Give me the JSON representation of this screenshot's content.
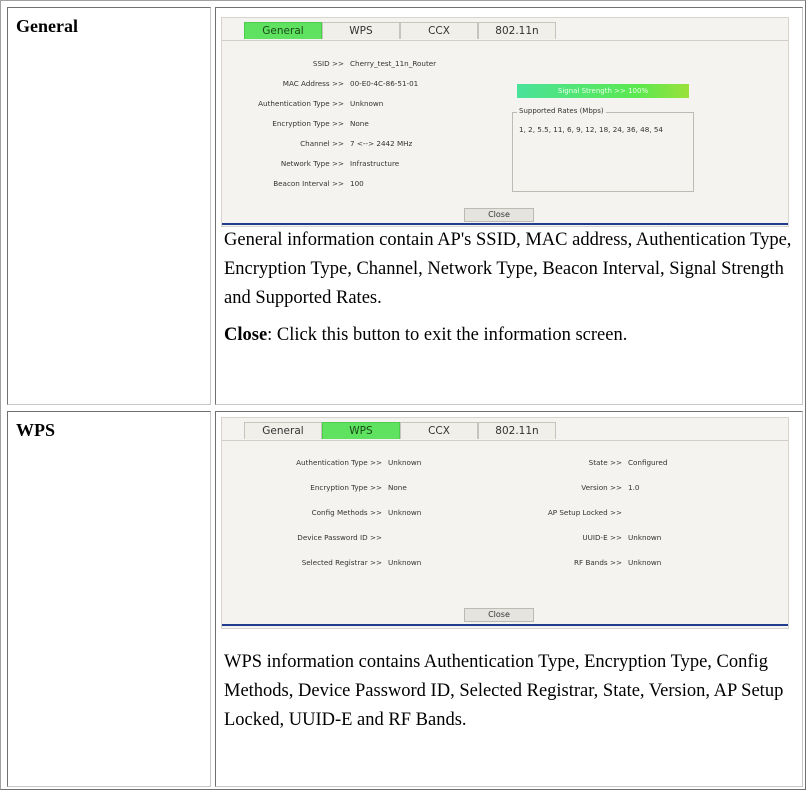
{
  "rows": [
    {
      "label": "General",
      "dialog": {
        "tabs": [
          "General",
          "WPS",
          "CCX",
          "802.11n"
        ],
        "active_tab": "General",
        "fields": [
          {
            "key": "SSID >>",
            "value": "Cherry_test_11n_Router"
          },
          {
            "key": "MAC Address >>",
            "value": "00-E0-4C-86-51-01"
          },
          {
            "key": "Authentication Type >>",
            "value": "Unknown"
          },
          {
            "key": "Encryption Type >>",
            "value": "None"
          },
          {
            "key": "Channel >>",
            "value": "7 <--> 2442 MHz"
          },
          {
            "key": "Network Type >>",
            "value": "Infrastructure"
          },
          {
            "key": "Beacon Interval >>",
            "value": "100"
          }
        ],
        "signal_text": "Signal Strength >> 100%",
        "signal_percent": 100,
        "rates_title": "Supported Rates (Mbps)",
        "rates_value": "1, 2, 5.5, 11, 6, 9, 12, 18, 24, 36, 48, 54",
        "close_label": "Close"
      },
      "description": "General information contain AP's SSID, MAC address, Authentication Type, Encryption Type, Channel, Network Type, Beacon Interval, Signal Strength and Supported Rates.",
      "close_term": "Close",
      "close_desc": ": Click this button to exit the information screen."
    },
    {
      "label": "WPS",
      "dialog": {
        "tabs": [
          "General",
          "WPS",
          "CCX",
          "802.11n"
        ],
        "active_tab": "WPS",
        "left_fields": [
          {
            "key": "Authentication Type >>",
            "value": "Unknown"
          },
          {
            "key": "Encryption Type >>",
            "value": "None"
          },
          {
            "key": "Config Methods >>",
            "value": "Unknown"
          },
          {
            "key": "Device Password ID >>",
            "value": ""
          },
          {
            "key": "Selected Registrar >>",
            "value": "Unknown"
          }
        ],
        "right_fields": [
          {
            "key": "State >>",
            "value": "Configured"
          },
          {
            "key": "Version >>",
            "value": "1.0"
          },
          {
            "key": "AP Setup Locked >>",
            "value": ""
          },
          {
            "key": "UUID-E >>",
            "value": "Unknown"
          },
          {
            "key": "RF Bands >>",
            "value": "Unknown"
          }
        ],
        "close_label": "Close"
      },
      "description": "WPS information contains Authentication Type, Encryption Type, Config Methods, Device Password ID, Selected Registrar, State, Version, AP Setup Locked, UUID-E and RF Bands."
    }
  ],
  "colors": {
    "active_tab": "#5fe25f",
    "panel_bg": "#f4f3ef",
    "blue_rule": "#1f3c8f"
  }
}
